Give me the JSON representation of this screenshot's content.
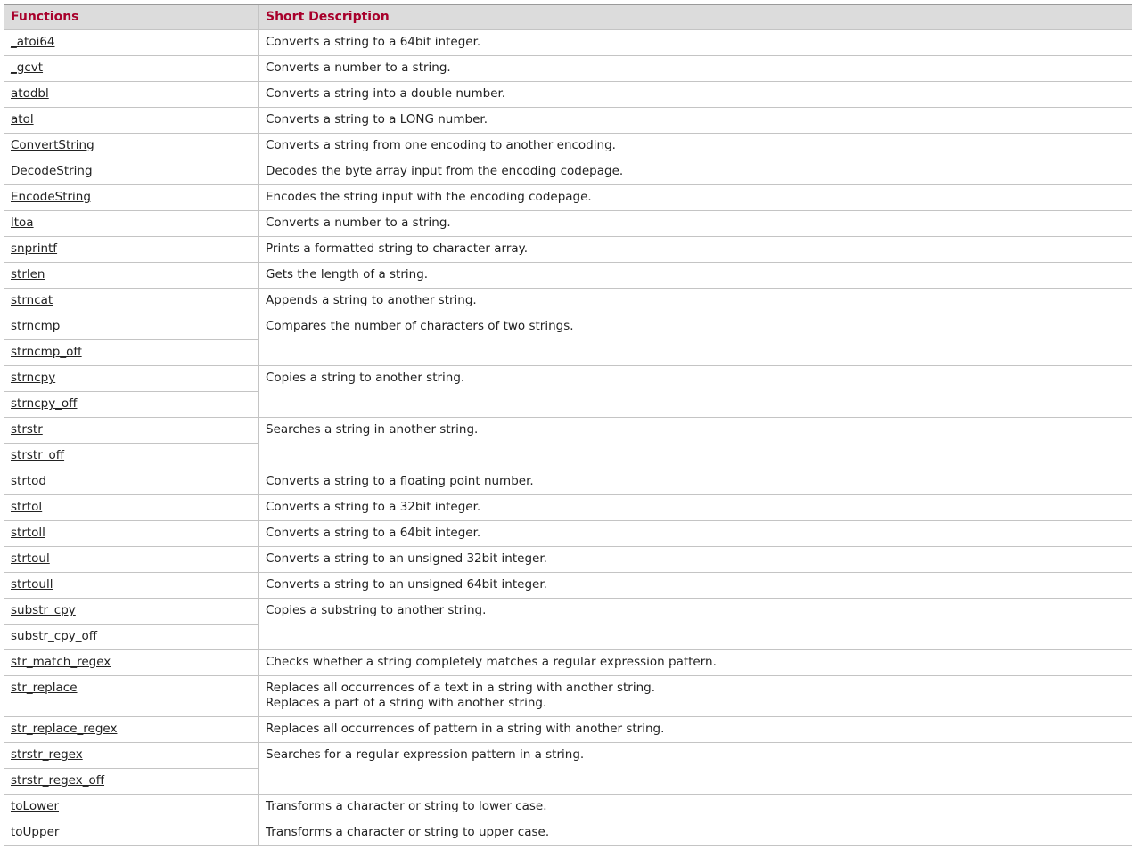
{
  "headers": {
    "functions": "Functions",
    "description": "Short Description"
  },
  "colors": {
    "header_text": "#a8002b",
    "header_bg": "#dcdcdc",
    "border": "#c4c4c4"
  },
  "groups": [
    {
      "functions": [
        "_atoi64"
      ],
      "description": [
        "Converts a string to a 64bit integer."
      ]
    },
    {
      "functions": [
        "_gcvt"
      ],
      "description": [
        "Converts a number to a string."
      ]
    },
    {
      "functions": [
        "atodbl"
      ],
      "description": [
        "Converts a string into a double number."
      ]
    },
    {
      "functions": [
        "atol"
      ],
      "description": [
        "Converts a string to a LONG number."
      ]
    },
    {
      "functions": [
        "ConvertString"
      ],
      "description": [
        "Converts a string from one encoding to another encoding."
      ]
    },
    {
      "functions": [
        "DecodeString"
      ],
      "description": [
        "Decodes the byte array input from the encoding codepage."
      ]
    },
    {
      "functions": [
        "EncodeString"
      ],
      "description": [
        "Encodes the string input with the encoding codepage."
      ]
    },
    {
      "functions": [
        "ltoa"
      ],
      "description": [
        "Converts a number to a string."
      ]
    },
    {
      "functions": [
        "snprintf"
      ],
      "description": [
        "Prints a formatted string to character array."
      ]
    },
    {
      "functions": [
        "strlen"
      ],
      "description": [
        "Gets the length of a string."
      ]
    },
    {
      "functions": [
        "strncat"
      ],
      "description": [
        "Appends a string to another string."
      ]
    },
    {
      "functions": [
        "strncmp",
        "strncmp_off"
      ],
      "description": [
        "Compares the number of characters of two strings."
      ]
    },
    {
      "functions": [
        "strncpy",
        "strncpy_off"
      ],
      "description": [
        "Copies a string to another string."
      ]
    },
    {
      "functions": [
        "strstr",
        "strstr_off"
      ],
      "description": [
        "Searches a string in another string."
      ]
    },
    {
      "functions": [
        "strtod"
      ],
      "description": [
        "Converts a string to a floating point number."
      ]
    },
    {
      "functions": [
        "strtol"
      ],
      "description": [
        "Converts a string to a 32bit integer."
      ]
    },
    {
      "functions": [
        "strtoll"
      ],
      "description": [
        "Converts a string to a 64bit integer."
      ]
    },
    {
      "functions": [
        "strtoul"
      ],
      "description": [
        "Converts a string to an unsigned 32bit integer."
      ]
    },
    {
      "functions": [
        "strtoull"
      ],
      "description": [
        "Converts a string to an unsigned 64bit integer."
      ]
    },
    {
      "functions": [
        "substr_cpy",
        "substr_cpy_off"
      ],
      "description": [
        "Copies a substring to another string."
      ]
    },
    {
      "functions": [
        "str_match_regex"
      ],
      "description": [
        "Checks whether a string completely matches a regular expression pattern."
      ]
    },
    {
      "functions": [
        "str_replace"
      ],
      "description": [
        "Replaces all occurrences of a text in a string with another string.",
        "Replaces a part of a string with another string."
      ]
    },
    {
      "functions": [
        "str_replace_regex"
      ],
      "description": [
        "Replaces all occurrences of pattern in a string with another string."
      ]
    },
    {
      "functions": [
        "strstr_regex",
        "strstr_regex_off"
      ],
      "description": [
        "Searches for a regular expression pattern in a string."
      ]
    },
    {
      "functions": [
        "toLower"
      ],
      "description": [
        "Transforms a character or string to lower case."
      ]
    },
    {
      "functions": [
        "toUpper"
      ],
      "description": [
        "Transforms a character or string to upper case."
      ]
    }
  ]
}
